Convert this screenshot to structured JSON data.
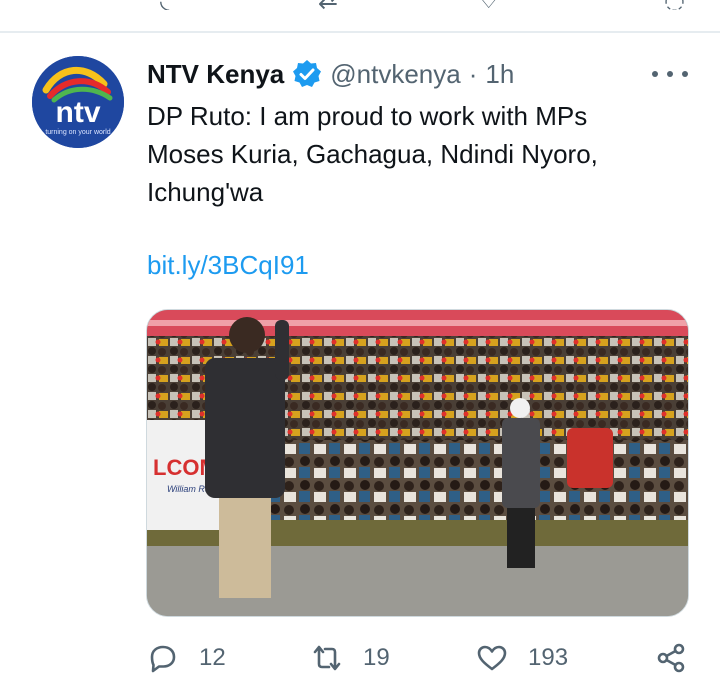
{
  "tweet": {
    "author_name": "NTV Kenya",
    "handle": "@ntvkenya",
    "separator": "·",
    "time": "1h",
    "text": "DP Ruto: I am proud to work with MPs Moses Kuria, Gachagua, Ndindi Nyoro, Ichung'wa",
    "link": "bit.ly/3BCqI91",
    "avatar": {
      "logo_text": "ntv",
      "tagline": "turning on your world",
      "brand_color": "#1f47a0"
    },
    "verified_color": "#1d9bf0",
    "media": {
      "icon": "photo-crowd-rally",
      "placard_text": "LCOM",
      "placard_sub": "William Ru"
    },
    "actions": {
      "reply": {
        "icon": "reply-icon",
        "count": "12"
      },
      "retweet": {
        "icon": "retweet-icon",
        "count": "19"
      },
      "like": {
        "icon": "heart-icon",
        "count": "193"
      },
      "share": {
        "icon": "share-icon"
      }
    }
  },
  "colors": {
    "text": "#0f1419",
    "secondary": "#536471",
    "link": "#1d9bf0",
    "divider": "#e6ecf0"
  }
}
